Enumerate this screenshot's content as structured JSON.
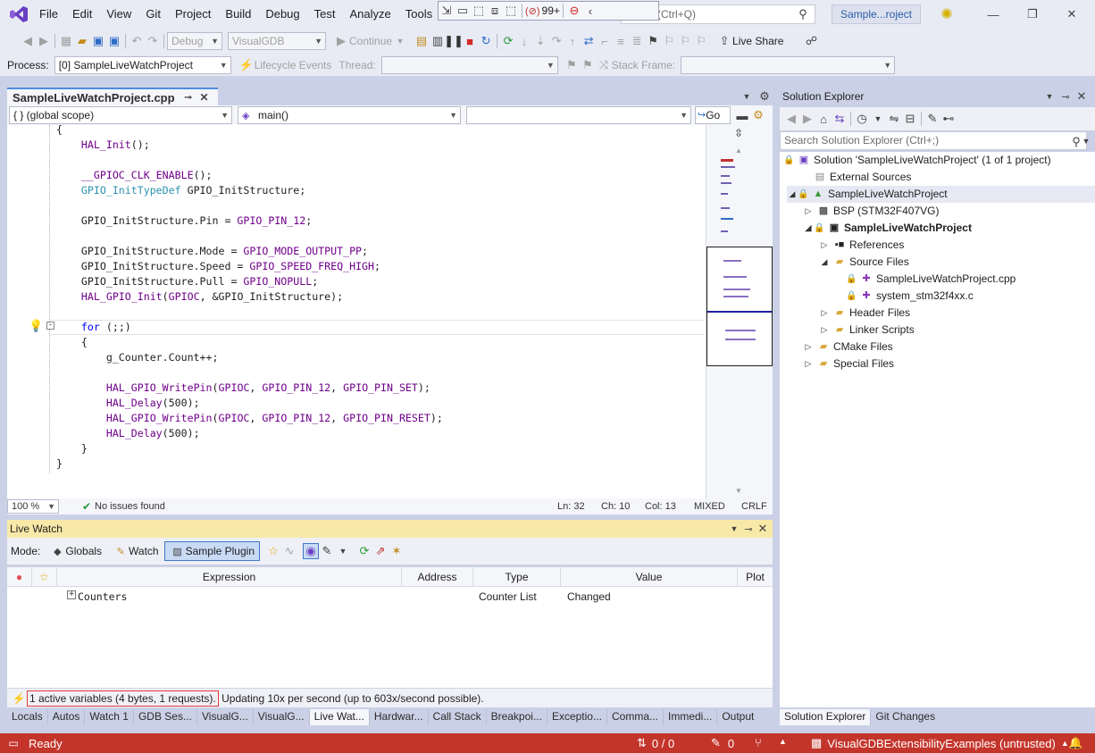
{
  "menu": [
    "File",
    "Edit",
    "View",
    "Git",
    "Project",
    "Build",
    "Debug",
    "Test",
    "Analyze",
    "Tools"
  ],
  "search": {
    "placeholder": "(Ctrl+Q)"
  },
  "debug_badge": "99+",
  "solution_badge": "Sample...roject",
  "toolbar": {
    "config": "Debug",
    "platform": "VisualGDB",
    "continue_label": "Continue",
    "live_share": "Live Share"
  },
  "toolbar2": {
    "process_label": "Process:",
    "process_value": "[0] SampleLiveWatchProject",
    "lifecycle_label": "Lifecycle Events",
    "thread_label": "Thread:",
    "stack_label": "Stack Frame:"
  },
  "editor": {
    "tab_title": "SampleLiveWatchProject.cpp",
    "scope": "{ }  (global scope)",
    "function": "main()",
    "go_label": "Go",
    "zoom": "100 %",
    "issues": "No issues found",
    "ln": "Ln: 32",
    "ch": "Ch: 10",
    "col": "Col: 13",
    "mixed": "MIXED",
    "eol": "CRLF"
  },
  "code": [
    "{",
    "    HAL_Init();",
    "",
    "    __GPIOC_CLK_ENABLE();",
    "    GPIO_InitTypeDef GPIO_InitStructure;",
    "",
    "    GPIO_InitStructure.Pin = GPIO_PIN_12;",
    "",
    "    GPIO_InitStructure.Mode = GPIO_MODE_OUTPUT_PP;",
    "    GPIO_InitStructure.Speed = GPIO_SPEED_FREQ_HIGH;",
    "    GPIO_InitStructure.Pull = GPIO_NOPULL;",
    "    HAL_GPIO_Init(GPIOC, &GPIO_InitStructure);",
    "",
    "    for (;;)",
    "    {",
    "        g_Counter.Count++;",
    "",
    "        HAL_GPIO_WritePin(GPIOC, GPIO_PIN_12, GPIO_PIN_SET);",
    "        HAL_Delay(500);",
    "        HAL_GPIO_WritePin(GPIOC, GPIO_PIN_12, GPIO_PIN_RESET);",
    "        HAL_Delay(500);",
    "    }",
    "}"
  ],
  "live_watch": {
    "title": "Live Watch",
    "mode_label": "Mode:",
    "modes": [
      "Globals",
      "Watch",
      "Sample Plugin"
    ],
    "columns": [
      "Expression",
      "Address",
      "Type",
      "Value",
      "Plot"
    ],
    "rows": [
      {
        "expression": "Counters",
        "address": "",
        "type": "Counter List",
        "value": "Changed"
      }
    ],
    "status_active": "1 active variables (4 bytes, 1 requests).",
    "status_rest": " Updating 10x per second (up to 603x/second possible)."
  },
  "bottom_tabs": [
    "Locals",
    "Autos",
    "Watch 1",
    "GDB Ses...",
    "VisualG...",
    "VisualG...",
    "Live Wat...",
    "Hardwar...",
    "Call Stack",
    "Breakpoi...",
    "Exceptio...",
    "Comma...",
    "Immedi...",
    "Output"
  ],
  "solution_explorer": {
    "title": "Solution Explorer",
    "search_placeholder": "Search Solution Explorer (Ctrl+;)",
    "nodes": [
      {
        "label": "Solution 'SampleLiveWatchProject' (1 of 1 project)",
        "icon": "solution-icon"
      },
      {
        "label": "External Sources",
        "icon": "external-sources-icon"
      },
      {
        "label": "SampleLiveWatchProject",
        "icon": "project-icon"
      },
      {
        "label": "BSP (STM32F407VG)",
        "icon": "chip-icon"
      },
      {
        "label": "SampleLiveWatchProject",
        "icon": "target-icon"
      },
      {
        "label": "References",
        "icon": "references-icon"
      },
      {
        "label": "Source Files",
        "icon": "folder-icon"
      },
      {
        "label": "SampleLiveWatchProject.cpp",
        "icon": "cpp-file-icon"
      },
      {
        "label": "system_stm32f4xx.c",
        "icon": "c-file-icon"
      },
      {
        "label": "Header Files",
        "icon": "folder-icon"
      },
      {
        "label": "Linker Scripts",
        "icon": "folder-icon"
      },
      {
        "label": "CMake Files",
        "icon": "folder-icon"
      },
      {
        "label": "Special Files",
        "icon": "folder-icon"
      }
    ],
    "bottom_tabs": [
      "Solution Explorer",
      "Git Changes"
    ]
  },
  "statusbar": {
    "ready": "Ready",
    "git_counts": "0 / 0",
    "edits": "0",
    "repo": "VisualGDBExtensibilityExamples (untrusted)"
  },
  "colors": {
    "accent": "#4d8fde",
    "statusbar": "#c3352b",
    "live_watch_title": "#f9e9a8"
  }
}
